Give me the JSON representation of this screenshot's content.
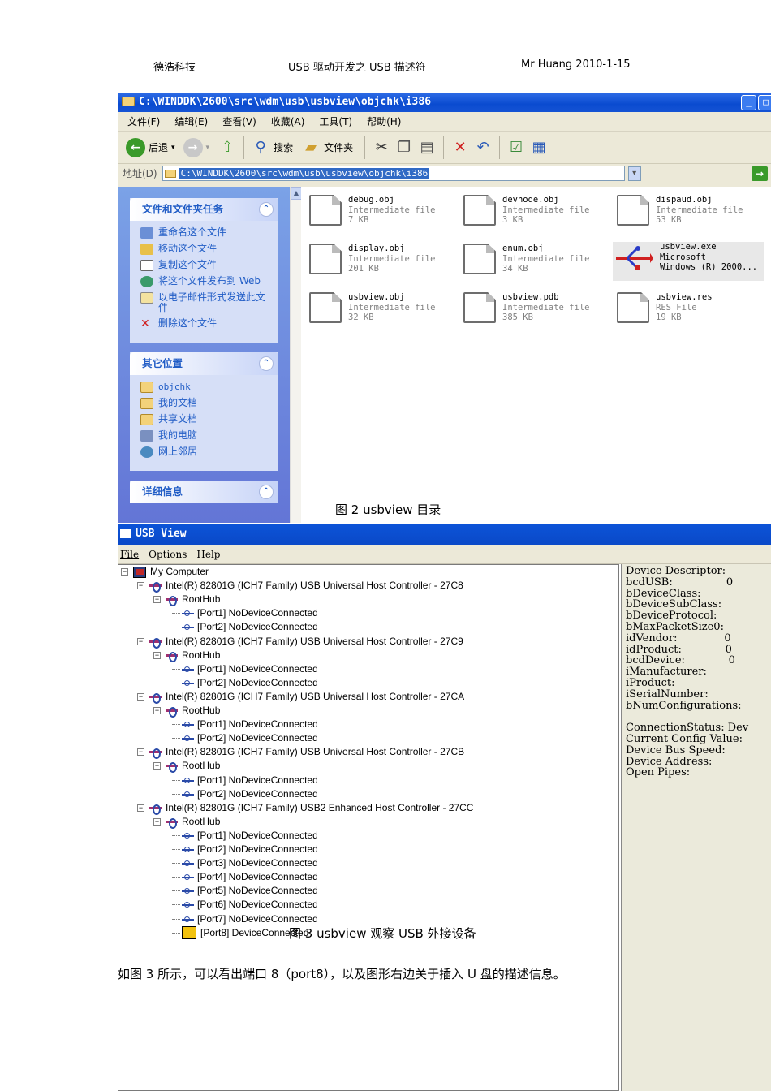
{
  "page_header": {
    "company": "德浩科技",
    "title": "USB 驱动开发之 USB 描述符",
    "author_date": "Mr Huang 2010-1-15"
  },
  "explorer": {
    "title": "C:\\WINDDK\\2600\\src\\wdm\\usb\\usbview\\objchk\\i386",
    "menu": [
      "文件(F)",
      "编辑(E)",
      "查看(V)",
      "收藏(A)",
      "工具(T)",
      "帮助(H)"
    ],
    "toolbar": {
      "back": "后退",
      "search": "搜索",
      "folders": "文件夹"
    },
    "address_label": "地址(D)",
    "address_value": "C:\\WINDDK\\2600\\src\\wdm\\usb\\usbview\\objchk\\i386",
    "tasks_panel": {
      "title": "文件和文件夹任务",
      "items": [
        "重命名这个文件",
        "移动这个文件",
        "复制这个文件",
        "将这个文件发布到 Web",
        "以电子邮件形式发送此文件",
        "删除这个文件"
      ]
    },
    "places_panel": {
      "title": "其它位置",
      "items": [
        "objchk",
        "我的文档",
        "共享文档",
        "我的电脑",
        "网上邻居"
      ]
    },
    "details_panel": {
      "title": "详细信息"
    },
    "files": [
      {
        "name": "debug.obj",
        "type": "Intermediate file",
        "size": "7 KB"
      },
      {
        "name": "devnode.obj",
        "type": "Intermediate file",
        "size": "3 KB"
      },
      {
        "name": "dispaud.obj",
        "type": "Intermediate file",
        "size": "53 KB"
      },
      {
        "name": "display.obj",
        "type": "Intermediate file",
        "size": "201 KB"
      },
      {
        "name": "enum.obj",
        "type": "Intermediate file",
        "size": "34 KB"
      },
      {
        "name": "usbview.exe",
        "type": "Microsoft",
        "size": "Windows (R) 2000..."
      },
      {
        "name": "usbview.obj",
        "type": "Intermediate file",
        "size": "32 KB"
      },
      {
        "name": "usbview.pdb",
        "type": "Intermediate file",
        "size": "385 KB"
      },
      {
        "name": "usbview.res",
        "type": "RES File",
        "size": "19 KB"
      }
    ]
  },
  "caption_fig2": "图 2 usbview 目录",
  "usbview": {
    "title": "USB View",
    "menu": [
      "File",
      "Options",
      "Help"
    ],
    "tree": {
      "root": "My Computer",
      "roothub_label": "RootHub",
      "controllers": [
        {
          "name": "Intel(R) 82801G (ICH7 Family) USB Universal Host Controller - 27C8",
          "ports": [
            "[Port1] NoDeviceConnected",
            "[Port2] NoDeviceConnected"
          ]
        },
        {
          "name": "Intel(R) 82801G (ICH7 Family) USB Universal Host Controller - 27C9",
          "ports": [
            "[Port1] NoDeviceConnected",
            "[Port2] NoDeviceConnected"
          ]
        },
        {
          "name": "Intel(R) 82801G (ICH7 Family) USB Universal Host Controller - 27CA",
          "ports": [
            "[Port1] NoDeviceConnected",
            "[Port2] NoDeviceConnected"
          ]
        },
        {
          "name": "Intel(R) 82801G (ICH7 Family) USB Universal Host Controller - 27CB",
          "ports": [
            "[Port1] NoDeviceConnected",
            "[Port2] NoDeviceConnected"
          ]
        },
        {
          "name": "Intel(R) 82801G (ICH7 Family) USB2 Enhanced Host Controller - 27CC",
          "ports": [
            "[Port1] NoDeviceConnected",
            "[Port2] NoDeviceConnected",
            "[Port3] NoDeviceConnected",
            "[Port4] NoDeviceConnected",
            "[Port5] NoDeviceConnected",
            "[Port6] NoDeviceConnected",
            "[Port7] NoDeviceConnected",
            "[Port8] DeviceConnected"
          ]
        }
      ]
    },
    "descriptor_text": "Device Descriptor:\nbcdUSB:                0\nbDeviceClass:\nbDeviceSubClass:\nbDeviceProtocol:\nbMaxPacketSize0:\nidVendor:              0\nidProduct:             0\nbcdDevice:             0\niManufacturer:\niProduct:\niSerialNumber:\nbNumConfigurations:\n\nConnectionStatus: Dev\nCurrent Config Value:\nDevice Bus Speed:\nDevice Address:\nOpen Pipes:"
  },
  "caption_fig3": "图 3  usbview 观察 USB 外接设备",
  "paragraph": "如图 3 所示，可以看出端口 8（port8），以及图形右边关于插入 U 盘的描述信息。"
}
